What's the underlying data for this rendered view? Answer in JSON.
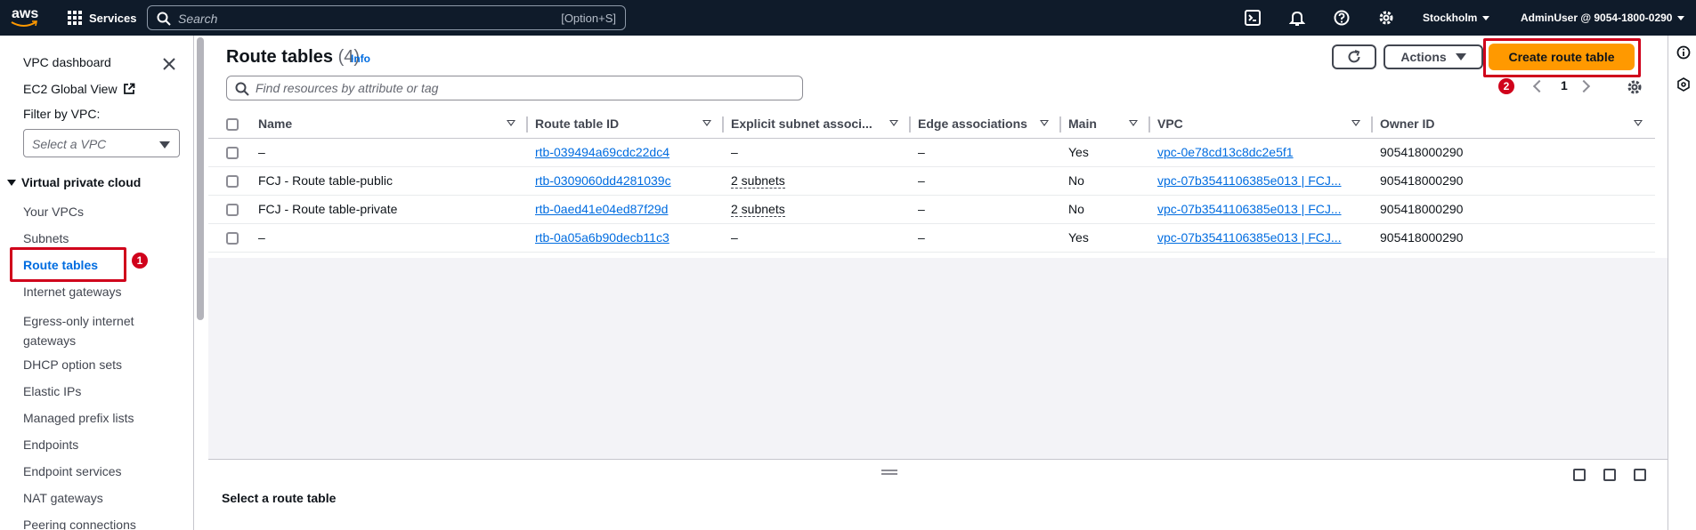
{
  "topnav": {
    "logo": "aws",
    "services_label": "Services",
    "search_placeholder": "Search",
    "search_shortcut": "[Option+S]",
    "icons": [
      "cloudshell-icon",
      "notifications-icon",
      "help-icon",
      "settings-icon"
    ],
    "region": "Stockholm",
    "account": "AdminUser @ 9054-1800-0290"
  },
  "sidebar": {
    "dashboard": "VPC dashboard",
    "ec2_global_view": "EC2 Global View",
    "filter_label": "Filter by VPC:",
    "filter_placeholder": "Select a VPC",
    "section": "Virtual private cloud",
    "items": [
      "Your VPCs",
      "Subnets",
      "Route tables",
      "Internet gateways",
      "Egress-only internet gateways",
      "DHCP option sets",
      "Elastic IPs",
      "Managed prefix lists",
      "Endpoints",
      "Endpoint services",
      "NAT gateways",
      "Peering connections"
    ],
    "egress_line1": "Egress-only internet",
    "egress_line2": "gateways",
    "active_item": "Route tables",
    "step_badge": "1"
  },
  "main": {
    "title": "Route tables",
    "count": "(4)",
    "info": "Info",
    "filter_placeholder": "Find resources by attribute or tag",
    "actions_label": "Actions",
    "create_label": "Create route table",
    "step_badge": "2",
    "page": "1",
    "columns": [
      "Name",
      "Route table ID",
      "Explicit subnet associ...",
      "Edge associations",
      "Main",
      "VPC",
      "Owner ID"
    ],
    "rows": [
      {
        "name": "–",
        "id": "rtb-039494a69cdc22dc4",
        "subnets": "–",
        "edge": "–",
        "main": "Yes",
        "vpc": "vpc-0e78cd13c8dc2e5f1",
        "owner": "905418000290"
      },
      {
        "name": "FCJ - Route table-public",
        "id": "rtb-0309060dd4281039c",
        "subnets": "2 subnets",
        "edge": "–",
        "main": "No",
        "vpc": "vpc-07b3541106385e013 | FCJ...",
        "owner": "905418000290"
      },
      {
        "name": "FCJ - Route table-private",
        "id": "rtb-0aed41e04ed87f29d",
        "subnets": "2 subnets",
        "edge": "–",
        "main": "No",
        "vpc": "vpc-07b3541106385e013 | FCJ...",
        "owner": "905418000290"
      },
      {
        "name": "–",
        "id": "rtb-0a05a6b90decb11c3",
        "subnets": "–",
        "edge": "–",
        "main": "Yes",
        "vpc": "vpc-07b3541106385e013 | FCJ...",
        "owner": "905418000290"
      }
    ],
    "split_panel_title": "Select a route table"
  },
  "colors": {
    "nav_bg": "#0f1b2a",
    "accent": "#006ce0",
    "primary_button": "#ff9900",
    "highlight": "#d0021b"
  }
}
